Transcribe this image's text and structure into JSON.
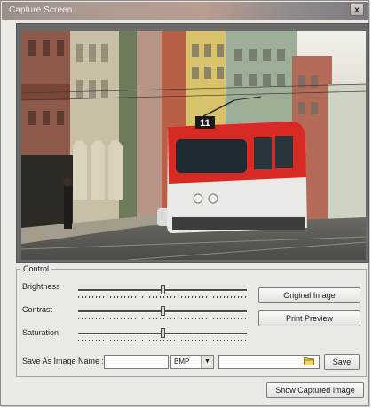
{
  "window": {
    "title": "Capture Screen",
    "close_symbol": "x"
  },
  "video": {
    "description_icon": "tram-street-video-frame",
    "tram_route": "11"
  },
  "control": {
    "group_label": "Control",
    "brightness": {
      "label": "Brightness",
      "level": 0.5
    },
    "contrast": {
      "label": "Contrast",
      "level": 0.5
    },
    "saturation": {
      "label": "Saturation",
      "level": 0.5
    },
    "original_image_label": "Original Image",
    "print_preview_label": "Print Preview",
    "save_as_label": "Save As Image Name :",
    "image_name_value": "",
    "format_value": "BMP",
    "path_value": "",
    "folder_icon": "folder-icon",
    "save_label": "Save"
  },
  "footer": {
    "show_captured_label": "Show Captured Image"
  }
}
